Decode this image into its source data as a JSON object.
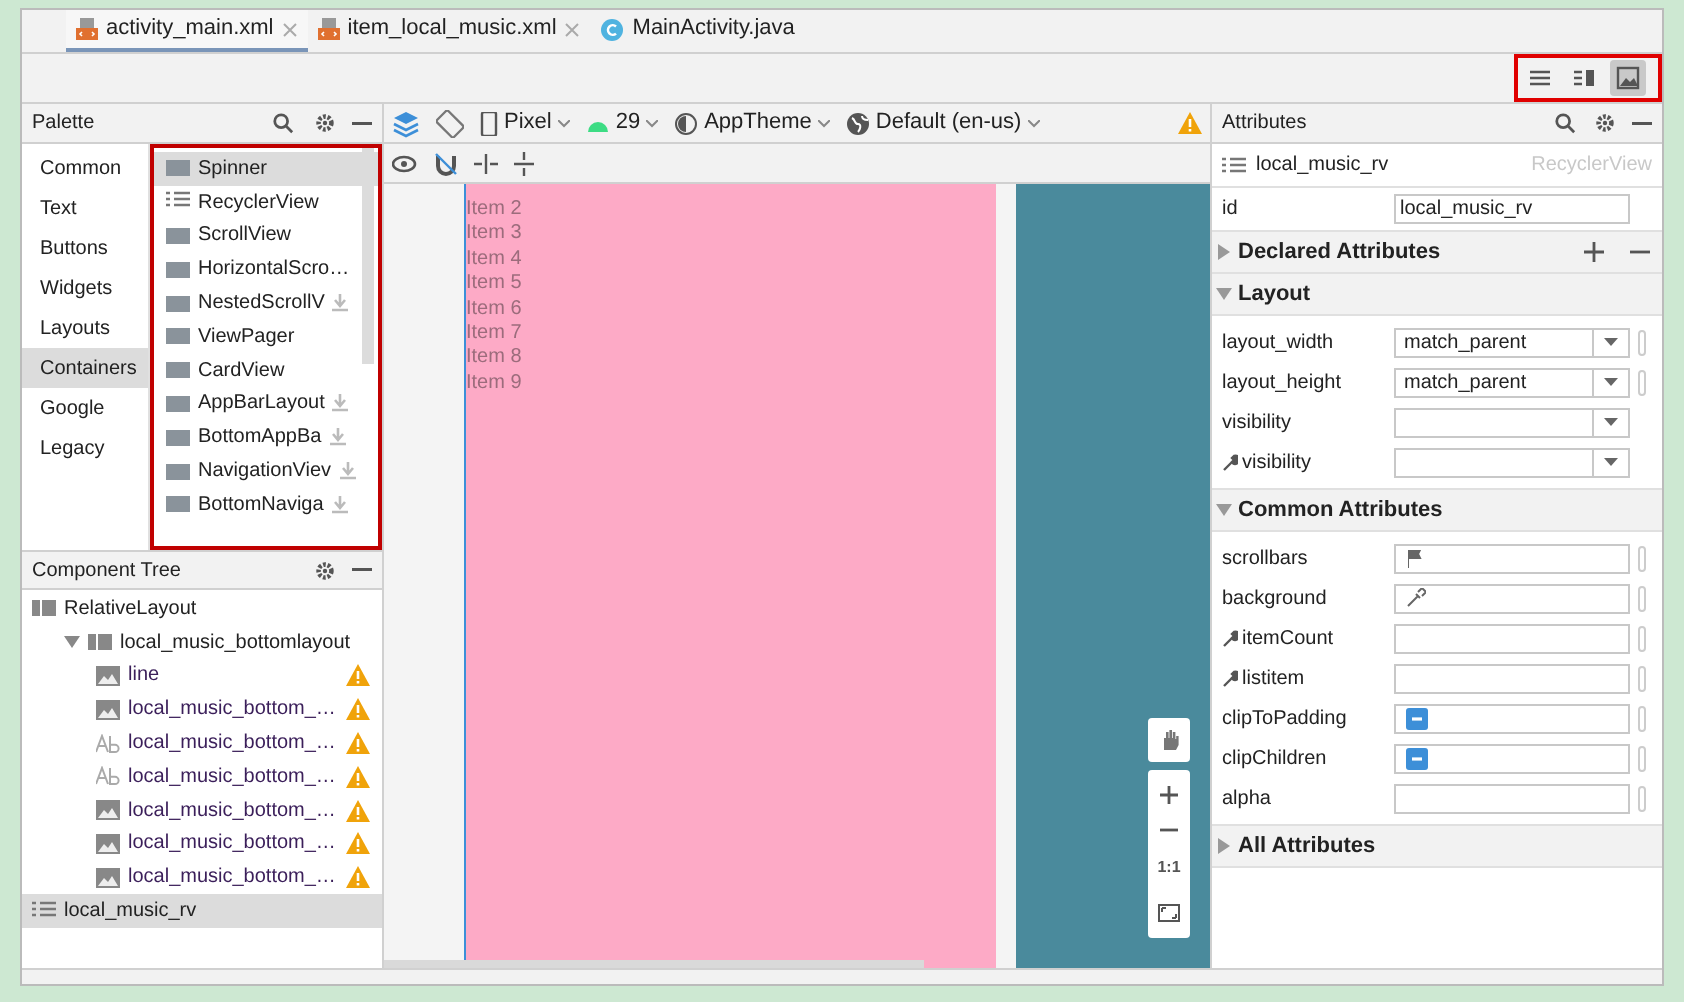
{
  "tabs": [
    {
      "label": "activity_main.xml",
      "kind": "xml",
      "selected": true
    },
    {
      "label": "item_local_music.xml",
      "kind": "xml",
      "selected": false
    },
    {
      "label": "MainActivity.java",
      "kind": "java",
      "selected": false
    }
  ],
  "view_modes": [
    {
      "kind": "code",
      "selected": false
    },
    {
      "kind": "split",
      "selected": false
    },
    {
      "kind": "design",
      "selected": true
    }
  ],
  "palette": {
    "title": "Palette",
    "categories": [
      {
        "label": "Common",
        "selected": false
      },
      {
        "label": "Text",
        "selected": false
      },
      {
        "label": "Buttons",
        "selected": false
      },
      {
        "label": "Widgets",
        "selected": false
      },
      {
        "label": "Layouts",
        "selected": false
      },
      {
        "label": "Containers",
        "selected": true
      },
      {
        "label": "Google",
        "selected": false
      },
      {
        "label": "Legacy",
        "selected": false
      }
    ],
    "items": [
      {
        "label": "Spinner",
        "selected": true,
        "download": false
      },
      {
        "label": "RecyclerView",
        "selected": false,
        "download": false
      },
      {
        "label": "ScrollView",
        "selected": false,
        "download": false
      },
      {
        "label": "HorizontalScro…",
        "selected": false,
        "download": false
      },
      {
        "label": "NestedScrollV",
        "selected": false,
        "download": true
      },
      {
        "label": "ViewPager",
        "selected": false,
        "download": false
      },
      {
        "label": "CardView",
        "selected": false,
        "download": false
      },
      {
        "label": "AppBarLayout",
        "selected": false,
        "download": true
      },
      {
        "label": "BottomAppBa",
        "selected": false,
        "download": true
      },
      {
        "label": "NavigationViev",
        "selected": false,
        "download": true
      },
      {
        "label": "BottomNaviga",
        "selected": false,
        "download": true
      }
    ]
  },
  "component_tree": {
    "title": "Component Tree",
    "nodes": [
      {
        "label": "RelativeLayout",
        "kind": "layout",
        "warning": false,
        "selected": false
      },
      {
        "label": "local_music_bottomlayout",
        "kind": "layout",
        "warning": false,
        "selected": false,
        "expanded": true,
        "children": [
          {
            "label": "line",
            "kind": "image",
            "warning": true,
            "selected": false
          },
          {
            "label": "local_music_bottom_…",
            "kind": "image",
            "warning": true,
            "selected": false
          },
          {
            "label": "local_music_bottom_…",
            "kind": "text",
            "warning": true,
            "selected": false
          },
          {
            "label": "local_music_bottom_…",
            "kind": "text",
            "warning": true,
            "selected": false
          },
          {
            "label": "local_music_bottom_…",
            "kind": "image",
            "warning": true,
            "selected": false
          },
          {
            "label": "local_music_bottom_…",
            "kind": "image",
            "warning": true,
            "selected": false
          },
          {
            "label": "local_music_bottom_…",
            "kind": "image",
            "warning": true,
            "selected": false
          }
        ]
      },
      {
        "label": "local_music_rv",
        "kind": "list",
        "warning": false,
        "selected": true
      }
    ]
  },
  "toolbar": {
    "device": "Pixel",
    "api": "29",
    "theme": "AppTheme",
    "locale": "Default (en-us)",
    "warning": true
  },
  "preview": {
    "items": [
      "Item 2",
      "Item 3",
      "Item 4",
      "Item 5",
      "Item 6",
      "Item 7",
      "Item 8",
      "Item 9"
    ]
  },
  "zoom_controls": {
    "actual_size": "1:1"
  },
  "attributes": {
    "title": "Attributes",
    "component": {
      "name": "local_music_rv",
      "type": "RecyclerView"
    },
    "id": {
      "label": "id",
      "value": "local_music_rv"
    },
    "sections": [
      {
        "title": "Declared Attributes",
        "expanded": false
      },
      {
        "title": "Layout",
        "expanded": true,
        "rows": [
          {
            "label": "layout_width",
            "kind": "dropdown",
            "value": "match_parent",
            "design_time": false
          },
          {
            "label": "layout_height",
            "kind": "dropdown",
            "value": "match_parent",
            "design_time": false
          },
          {
            "label": "visibility",
            "kind": "dropdown",
            "design_time": false
          },
          {
            "label": "visibility",
            "kind": "dropdown",
            "design_time": true
          }
        ]
      },
      {
        "title": "Common Attributes",
        "expanded": true,
        "rows": [
          {
            "label": "scrollbars",
            "kind": "flag",
            "design_time": false
          },
          {
            "label": "background",
            "kind": "color",
            "design_time": false
          },
          {
            "label": "itemCount",
            "kind": "text",
            "design_time": true
          },
          {
            "label": "listitem",
            "kind": "text",
            "design_time": true
          },
          {
            "label": "clipToPadding",
            "kind": "tristate",
            "design_time": false
          },
          {
            "label": "clipChildren",
            "kind": "tristate",
            "design_time": false
          },
          {
            "label": "alpha",
            "kind": "text",
            "design_time": false
          }
        ]
      },
      {
        "title": "All Attributes",
        "expanded": false
      }
    ]
  }
}
